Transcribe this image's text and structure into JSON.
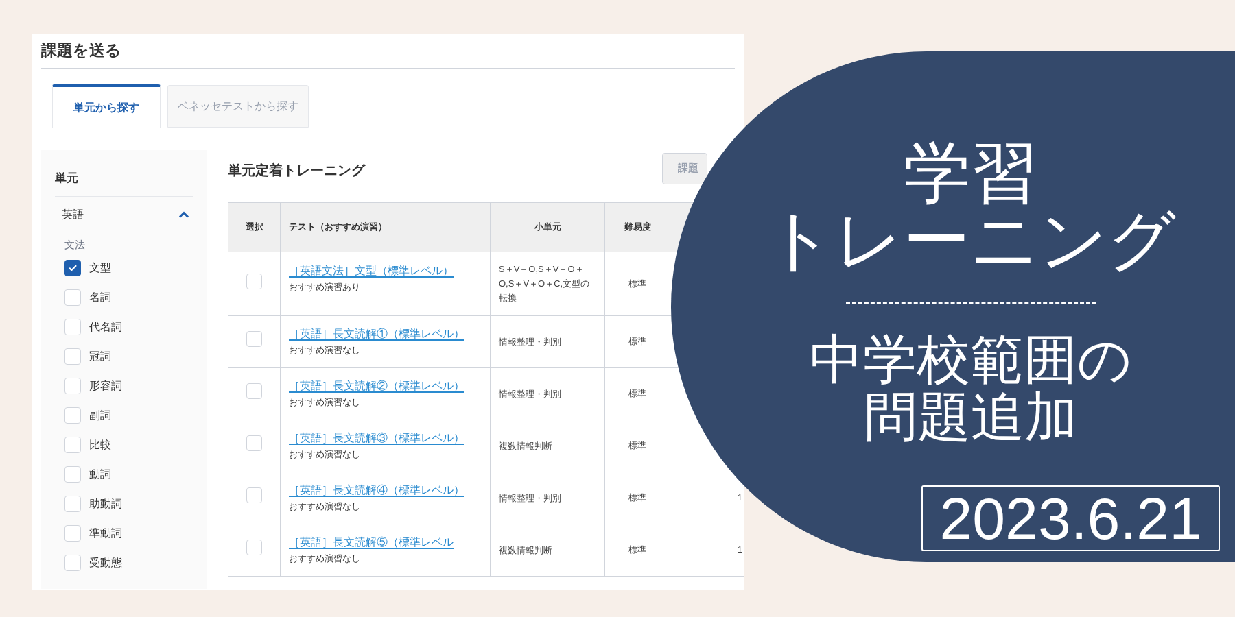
{
  "page": {
    "title": "課題を送る"
  },
  "tabs": [
    {
      "label": "単元から探す",
      "selected": true
    },
    {
      "label": "ベネッセテストから探す",
      "selected": false
    }
  ],
  "sidebar": {
    "heading": "単元",
    "subject": {
      "label": "英語",
      "expanded": true
    },
    "group": "文法",
    "items": [
      {
        "label": "文型",
        "checked": true
      },
      {
        "label": "名詞",
        "checked": false
      },
      {
        "label": "代名詞",
        "checked": false
      },
      {
        "label": "冠詞",
        "checked": false
      },
      {
        "label": "形容詞",
        "checked": false
      },
      {
        "label": "副詞",
        "checked": false
      },
      {
        "label": "比較",
        "checked": false
      },
      {
        "label": "動詞",
        "checked": false
      },
      {
        "label": "助動詞",
        "checked": false
      },
      {
        "label": "準動詞",
        "checked": false
      },
      {
        "label": "受動態",
        "checked": false
      }
    ]
  },
  "main": {
    "heading": "単元定着トレーニング",
    "create_button": "課題",
    "table": {
      "columns": [
        {
          "lines": [
            "選択"
          ]
        },
        {
          "lines": [
            "テスト（おすすめ演習）"
          ]
        },
        {
          "lines": [
            "小単元"
          ]
        },
        {
          "lines": [
            "難易度"
          ]
        },
        {}
      ],
      "rows": [
        {
          "selected": false,
          "test": "［英語文法］文型（標準レベル）",
          "note": "おすすめ演習あり",
          "unit": "S＋V＋O,S＋V＋O＋O,S＋V＋O＋C,文型の転換",
          "difficulty": "標準"
        },
        {
          "selected": false,
          "test": "［英語］長文読解①（標準レベル）",
          "note": "おすすめ演習なし",
          "unit": "情報整理・判別",
          "difficulty": "標準"
        },
        {
          "selected": false,
          "test": "［英語］長文読解②（標準レベル）",
          "note": "おすすめ演習なし",
          "unit": "情報整理・判別",
          "difficulty": "標準"
        },
        {
          "selected": false,
          "test": "［英語］長文読解③（標準レベル）",
          "note": "おすすめ演習なし",
          "unit": "複数情報判断",
          "difficulty": "標準"
        },
        {
          "selected": false,
          "test": "［英語］長文読解④（標準レベル）",
          "note": "おすすめ演習なし",
          "unit": "情報整理・判別",
          "difficulty": "標準",
          "count": "1"
        },
        {
          "selected": false,
          "test": "［英語］長文読解⑤（標準レベル",
          "note": "おすすめ演習なし",
          "unit": "複数情報判断",
          "difficulty": "標準",
          "count": "1"
        }
      ]
    }
  },
  "banner": {
    "title_lines": [
      "学習",
      "トレーニング"
    ],
    "subtitle_lines": [
      "中学校範囲の",
      "問題追加"
    ],
    "date": "2023.6.21"
  }
}
